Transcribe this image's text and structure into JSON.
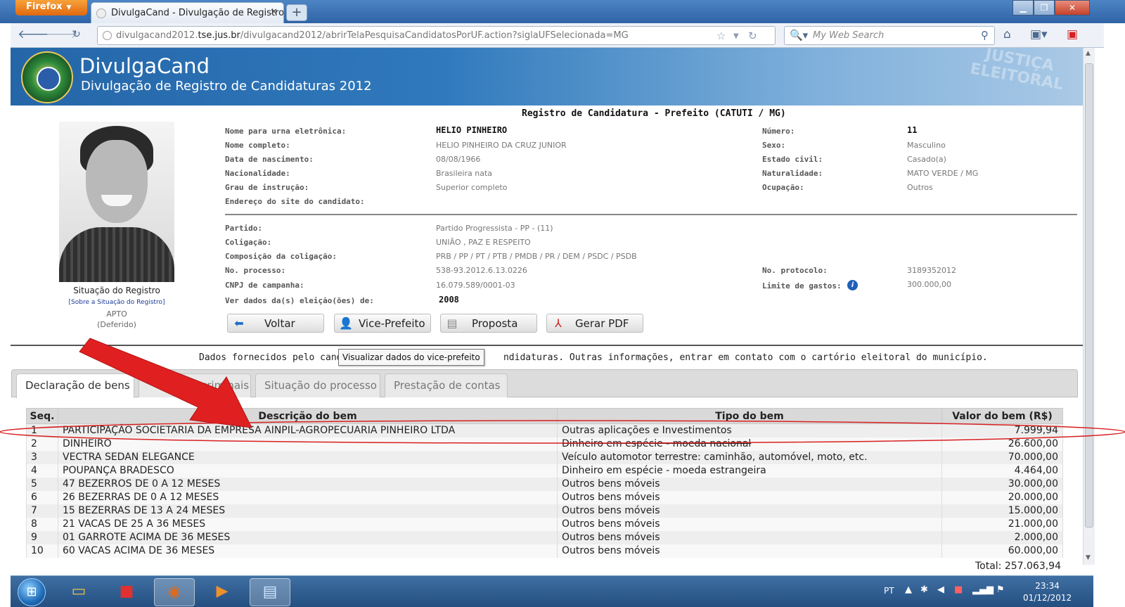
{
  "browser": {
    "menu_label": "Firefox",
    "tab_title": "DivulgaCand - Divulgação de Registro d...",
    "url_prefix": "divulgacand2012.",
    "url_host": "tse.jus.br",
    "url_rest": "/divulgacand2012/abrirTelaPesquisaCandidatosPorUF.action?siglaUFSelecionada=MG",
    "search_placeholder": "My Web Search"
  },
  "site": {
    "title": "DivulgaCand",
    "subtitle": "Divulgação de Registro de Candidaturas 2012",
    "watermark": "JUSTIÇA\nELEITORAL"
  },
  "page": {
    "heading": "Registro de Candidatura - Prefeito (CATUTI / MG)"
  },
  "candidate": {
    "situation_label": "Situação do Registro",
    "situation_link": "[Sobre a Situação do Registro]",
    "situation_status": "APTO",
    "situation_detail": "(Deferido)",
    "fields_left": [
      {
        "label": "Nome para urna eletrônica:",
        "value": "HELIO PINHEIRO"
      },
      {
        "label": "Nome completo:",
        "value": "HELIO PINHEIRO DA CRUZ JUNIOR"
      },
      {
        "label": "Data de nascimento:",
        "value": "08/08/1966"
      },
      {
        "label": "Nacionalidade:",
        "value": "Brasileira nata"
      },
      {
        "label": "Grau de instrução:",
        "value": "Superior completo"
      },
      {
        "label": "Endereço do site do candidato:",
        "value": ""
      }
    ],
    "fields_right": [
      {
        "label": "Número:",
        "value": "11"
      },
      {
        "label": "Sexo:",
        "value": "Masculino"
      },
      {
        "label": "Estado civil:",
        "value": "Casado(a)"
      },
      {
        "label": "Naturalidade:",
        "value": "MATO VERDE / MG"
      },
      {
        "label": "Ocupação:",
        "value": "Outros"
      }
    ],
    "fields_party": [
      {
        "label": "Partido:",
        "value": "Partido Progressista - PP - (11)"
      },
      {
        "label": "Coligação:",
        "value": "UNIÃO , PAZ E RESPEITO"
      },
      {
        "label": "Composição da coligação:",
        "value": "PRB / PP / PT / PTB / PMDB / PR / DEM / PSDC / PSDB"
      },
      {
        "label": "No. processo:",
        "value": "538-93.2012.6.13.0226"
      },
      {
        "label": "CNPJ de campanha:",
        "value": "16.079.589/0001-03"
      },
      {
        "label": "Ver dados da(s) eleição(ões) de:",
        "value": "2008"
      }
    ],
    "fields_party_right": [
      {
        "label": "No. protocolo:",
        "value": "3189352012"
      },
      {
        "label": "Limite de gastos:",
        "value": "300.000,00"
      }
    ]
  },
  "buttons": {
    "back": "Voltar",
    "vice": "Vice-Prefeito",
    "proposal": "Proposta",
    "pdf": "Gerar PDF"
  },
  "tooltip": "Visualizar dados do vice-prefeito",
  "notice": {
    "before": "Dados fornecidos pelo candida",
    "after": "ndidaturas.  Outras informações, entrar em contato com o cartório eleitoral do município."
  },
  "tabs": [
    {
      "label": "Declaração de bens"
    },
    {
      "label": "criminais"
    },
    {
      "label": "Situação do processo"
    },
    {
      "label": "Prestação de contas"
    }
  ],
  "table": {
    "headers": [
      "Seq.",
      "Descrição do bem",
      "Tipo do bem",
      "Valor do bem (R$)"
    ],
    "rows": [
      [
        "1",
        "PARTICIPAÇÃO SOCIETARIA DA EMPRESA AINPIL-AGROPECUARIA PINHEIRO LTDA",
        "Outras aplicações e Investimentos",
        "7.999,94"
      ],
      [
        "2",
        "DINHEIRO",
        "Dinheiro em espécie - moeda nacional",
        "26.600,00"
      ],
      [
        "3",
        "VECTRA SEDAN ELEGANCE",
        "Veículo automotor terrestre: caminhão, automóvel, moto, etc.",
        "70.000,00"
      ],
      [
        "4",
        "POUPANÇA BRADESCO",
        "Dinheiro em espécie - moeda estrangeira",
        "4.464,00"
      ],
      [
        "5",
        "47 BEZERROS DE 0 A 12 MESES",
        "Outros bens móveis",
        "30.000,00"
      ],
      [
        "6",
        "26 BEZERRAS DE 0 A 12 MESES",
        "Outros bens móveis",
        "20.000,00"
      ],
      [
        "7",
        "15 BEZERRAS DE 13 A 24 MESES",
        "Outros bens móveis",
        "15.000,00"
      ],
      [
        "8",
        "21 VACAS DE 25 A 36 MESES",
        "Outros bens móveis",
        "21.000,00"
      ],
      [
        "9",
        "01 GARROTE ACIMA DE 36 MESES",
        "Outros bens móveis",
        "2.000,00"
      ],
      [
        "10",
        "60 VACAS ACIMA DE 36 MESES",
        "Outros bens móveis",
        "60.000,00"
      ]
    ],
    "total": "Total: 257.063,94"
  },
  "taskbar": {
    "lang": "PT",
    "time": "23:34",
    "date": "01/12/2012"
  },
  "colors": {
    "banner_blue": "#2566a8",
    "annotation_red": "#e02020"
  }
}
